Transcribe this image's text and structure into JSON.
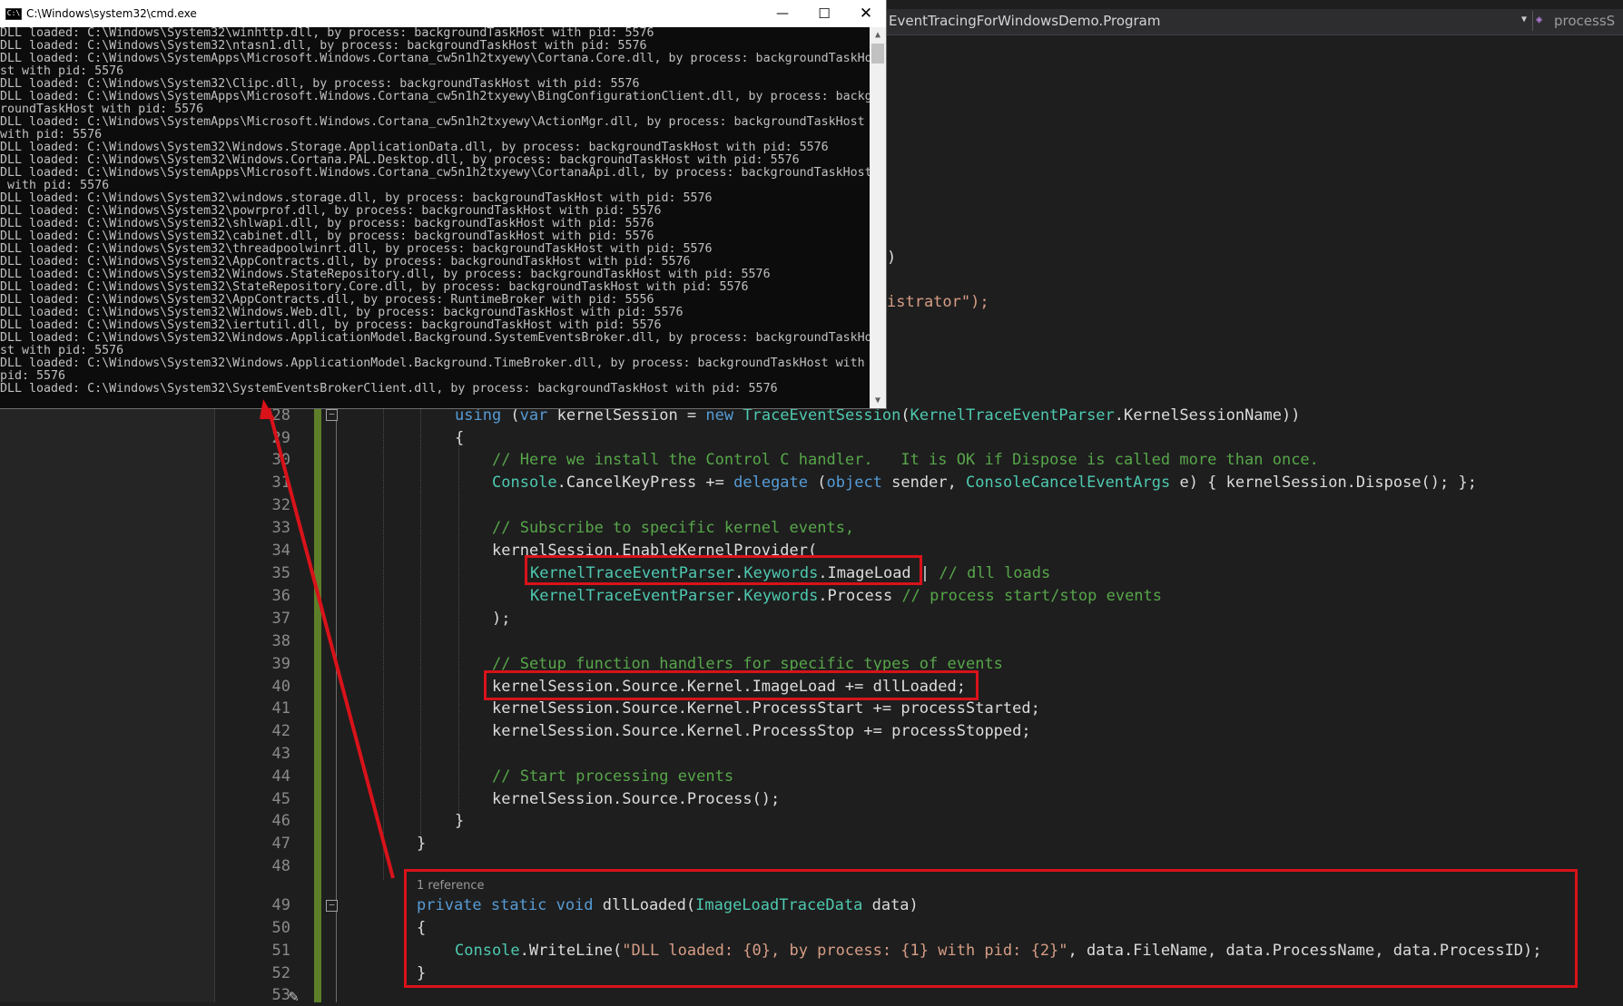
{
  "cmd": {
    "title": "C:\\Windows\\system32\\cmd.exe",
    "icon_label": "C:\\",
    "window_buttons": {
      "minimize": "—",
      "maximize": "☐",
      "close": "✕"
    },
    "lines": [
      "DLL loaded: C:\\Windows\\System32\\winhttp.dll, by process: backgroundTaskHost with pid: 5576",
      "DLL loaded: C:\\Windows\\System32\\ntasn1.dll, by process: backgroundTaskHost with pid: 5576",
      "DLL loaded: C:\\Windows\\SystemApps\\Microsoft.Windows.Cortana_cw5n1h2txyewy\\Cortana.Core.dll, by process: backgroundTaskHo",
      "st with pid: 5576",
      "DLL loaded: C:\\Windows\\System32\\Clipc.dll, by process: backgroundTaskHost with pid: 5576",
      "DLL loaded: C:\\Windows\\SystemApps\\Microsoft.Windows.Cortana_cw5n1h2txyewy\\BingConfigurationClient.dll, by process: backg",
      "roundTaskHost with pid: 5576",
      "DLL loaded: C:\\Windows\\SystemApps\\Microsoft.Windows.Cortana_cw5n1h2txyewy\\ActionMgr.dll, by process: backgroundTaskHost",
      "with pid: 5576",
      "DLL loaded: C:\\Windows\\System32\\Windows.Storage.ApplicationData.dll, by process: backgroundTaskHost with pid: 5576",
      "DLL loaded: C:\\Windows\\System32\\Windows.Cortana.PAL.Desktop.dll, by process: backgroundTaskHost with pid: 5576",
      "DLL loaded: C:\\Windows\\SystemApps\\Microsoft.Windows.Cortana_cw5n1h2txyewy\\CortanaApi.dll, by process: backgroundTaskHost",
      " with pid: 5576",
      "DLL loaded: C:\\Windows\\System32\\windows.storage.dll, by process: backgroundTaskHost with pid: 5576",
      "DLL loaded: C:\\Windows\\System32\\powrprof.dll, by process: backgroundTaskHost with pid: 5576",
      "DLL loaded: C:\\Windows\\System32\\shlwapi.dll, by process: backgroundTaskHost with pid: 5576",
      "DLL loaded: C:\\Windows\\System32\\cabinet.dll, by process: backgroundTaskHost with pid: 5576",
      "DLL loaded: C:\\Windows\\System32\\threadpoolwinrt.dll, by process: backgroundTaskHost with pid: 5576",
      "DLL loaded: C:\\Windows\\System32\\AppContracts.dll, by process: backgroundTaskHost with pid: 5576",
      "DLL loaded: C:\\Windows\\System32\\Windows.StateRepository.dll, by process: backgroundTaskHost with pid: 5576",
      "DLL loaded: C:\\Windows\\System32\\StateRepository.Core.dll, by process: backgroundTaskHost with pid: 5576",
      "DLL loaded: C:\\Windows\\System32\\AppContracts.dll, by process: RuntimeBroker with pid: 5556",
      "DLL loaded: C:\\Windows\\System32\\Windows.Web.dll, by process: backgroundTaskHost with pid: 5576",
      "DLL loaded: C:\\Windows\\System32\\iertutil.dll, by process: backgroundTaskHost with pid: 5576",
      "DLL loaded: C:\\Windows\\System32\\Windows.ApplicationModel.Background.SystemEventsBroker.dll, by process: backgroundTaskHo",
      "st with pid: 5576",
      "DLL loaded: C:\\Windows\\System32\\Windows.ApplicationModel.Background.TimeBroker.dll, by process: backgroundTaskHost with",
      "pid: 5576",
      "DLL loaded: C:\\Windows\\System32\\SystemEventsBrokerClient.dll, by process: backgroundTaskHost with pid: 5576"
    ]
  },
  "editor": {
    "nav_type": "EventTracingForWindowsDemo.Program",
    "nav_member": "processS",
    "partial_lines": {
      "paren": ")",
      "administrator": "istrator\");"
    },
    "reference_hint": "1 reference",
    "line_numbers": [
      "28",
      "29",
      "30",
      "31",
      "32",
      "33",
      "34",
      "35",
      "36",
      "37",
      "38",
      "39",
      "40",
      "41",
      "42",
      "43",
      "44",
      "45",
      "46",
      "47",
      "48",
      "49",
      "50",
      "51",
      "52",
      "53"
    ],
    "tokens": {
      "l28": [
        "using",
        " (",
        "var",
        " kernelSession = ",
        "new",
        " ",
        "TraceEventSession",
        "(",
        "KernelTraceEventParser",
        ".KernelSessionName))"
      ],
      "l29": [
        "{"
      ],
      "l30": [
        "// Here we install the Control C handler.   It is OK if Dispose is called more than once."
      ],
      "l31": [
        "Console",
        ".CancelKeyPress += ",
        "delegate",
        " (",
        "object",
        " sender, ",
        "ConsoleCancelEventArgs",
        " e) { kernelSession.Dispose(); };"
      ],
      "l33": [
        "// Subscribe to specific kernel events,"
      ],
      "l34": [
        "kernelSession.EnableKernelProvider("
      ],
      "l35": [
        "KernelTraceEventParser",
        ".",
        "Keywords",
        ".ImageLoad",
        " | ",
        "// dll loads"
      ],
      "l36": [
        "KernelTraceEventParser",
        ".",
        "Keywords",
        ".Process ",
        "// process start/stop events"
      ],
      "l37": [
        ");"
      ],
      "l39": [
        "// Setup function handlers for specific types of events"
      ],
      "l40": [
        "kernelSession.Source.Kernel.ImageLoad += dllLoaded;"
      ],
      "l41": [
        "kernelSession.Source.Kernel.ProcessStart += processStarted;"
      ],
      "l42": [
        "kernelSession.Source.Kernel.ProcessStop += processStopped;"
      ],
      "l44": [
        "// Start processing events"
      ],
      "l45": [
        "kernelSession.Source.Process();"
      ],
      "l46": [
        "}"
      ],
      "l47": [
        "}"
      ],
      "l49": [
        "private",
        " ",
        "static",
        " ",
        "void",
        " dllLoaded(",
        "ImageLoadTraceData",
        " data)"
      ],
      "l50": [
        "{"
      ],
      "l51": [
        "Console",
        ".WriteLine(",
        "\"DLL loaded: {0}, by process: {1} with pid: {2}\"",
        ", data.FileName, data.ProcessName, data.ProcessID);"
      ],
      "l52": [
        "}"
      ]
    }
  },
  "colors": {
    "keyword": "#569cd6",
    "type": "#4ec9b0",
    "comment": "#57a64a",
    "string": "#d69d85",
    "highlight_box": "#d9121a",
    "arrow": "#d9121a"
  },
  "icons": {
    "cmd_icon": "console-icon",
    "collapse": "collapse-minus-icon",
    "class": "class-icon",
    "method": "method-icon",
    "edit_cursor": "pencil-icon"
  }
}
